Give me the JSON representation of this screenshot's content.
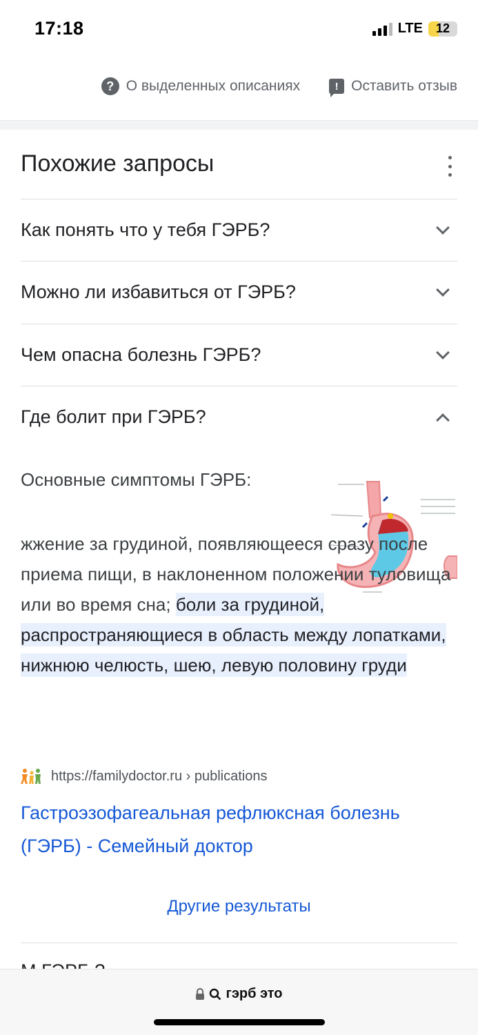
{
  "status_bar": {
    "time": "17:18",
    "network": "LTE",
    "battery": "12",
    "battery_level": 0.12,
    "battery_color": "#f7d54a"
  },
  "feedback": {
    "about_label": "О выделенных описаниях",
    "about_icon": "help-circle-icon",
    "feedback_label": "Оставить отзыв",
    "feedback_icon": "feedback-icon"
  },
  "related": {
    "title": "Похожие запросы",
    "questions": [
      {
        "text": "Как понять что у тебя ГЭРБ?",
        "expanded": false
      },
      {
        "text": "Можно ли избавиться от ГЭРБ?",
        "expanded": false
      },
      {
        "text": "Чем опасна болезнь ГЭРБ?",
        "expanded": false
      },
      {
        "text": "Где болит при ГЭРБ?",
        "expanded": true
      }
    ]
  },
  "answer": {
    "lead": "Основные симптомы ГЭРБ:",
    "text_plain": "жжение за грудиной, появляющееся сразу после приема пищи, в наклоненном положении туловища или во время сна;",
    "text_highlight": "боли за грудиной, распространяющиеся в область между лопатками, нижнюю челюсть, шею, левую половину груди",
    "image_desc_icon": "stomach-diagram-image"
  },
  "source": {
    "favicon": "family-favicon-icon",
    "url": "https://familydoctor.ru › publications",
    "title": "Гастроэзофагеальная рефлюксная болезнь (ГЭРБ) - Семейный доктор"
  },
  "more_results": "Другие результаты",
  "peek_text": "М                                ГЭРБ          ?",
  "address_bar": {
    "query": "гэрб это",
    "lock_icon": "lock-icon",
    "search_icon": "search-icon"
  },
  "colors": {
    "link": "#1558d6",
    "highlight": "#e8f0fe",
    "text": "#202124",
    "secondary": "#5f6368"
  }
}
